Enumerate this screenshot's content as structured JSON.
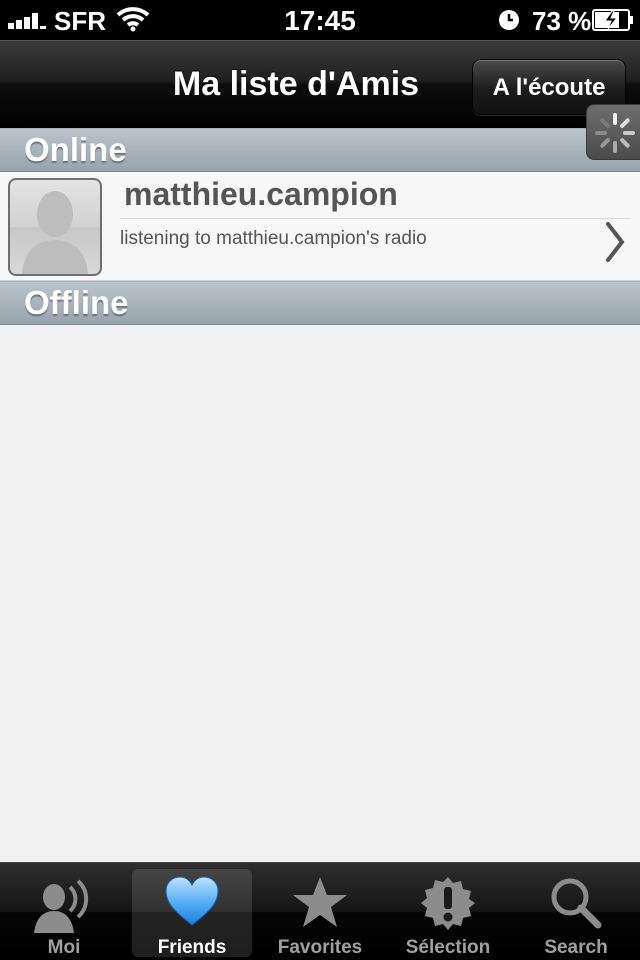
{
  "status_bar": {
    "carrier": "SFR",
    "time": "17:45",
    "battery_percent": "73 %",
    "signal_bars": 4
  },
  "navbar": {
    "title": "Ma liste d'Amis",
    "listen_button": "A l'écoute"
  },
  "sections": {
    "online": "Online",
    "offline": "Offline"
  },
  "friends_online": [
    {
      "name": "matthieu.campion",
      "status": "listening to matthieu.campion's radio",
      "avatar_icon": "person-silhouette-icon"
    }
  ],
  "tabbar": {
    "tabs": [
      {
        "label": "Moi",
        "icon": "person-speaking-icon"
      },
      {
        "label": "Friends",
        "icon": "heart-icon",
        "active": true
      },
      {
        "label": "Favorites",
        "icon": "star-icon"
      },
      {
        "label": "Sélection",
        "icon": "exclamation-badge-icon"
      },
      {
        "label": "Search",
        "icon": "magnifier-icon"
      }
    ]
  },
  "colors": {
    "navbar": "#000000",
    "section_header": "#a6b1b9",
    "content_bg": "#f1f1f1",
    "active_heart": "#3d9ef0"
  }
}
